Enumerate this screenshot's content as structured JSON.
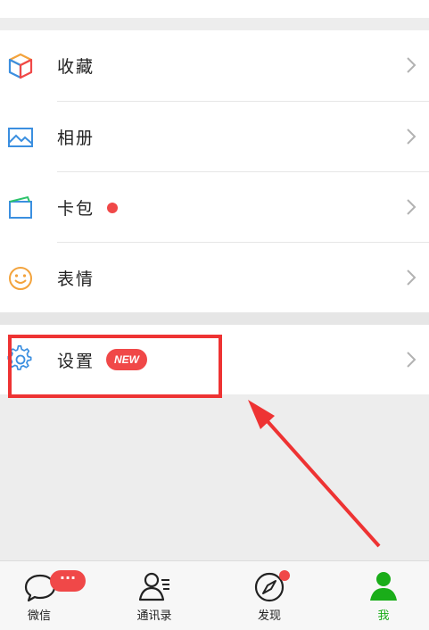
{
  "menu": {
    "items": [
      {
        "label": "收藏",
        "icon": "favorites-cube-icon"
      },
      {
        "label": "相册",
        "icon": "photo-album-icon"
      },
      {
        "label": "卡包",
        "icon": "card-wallet-icon",
        "has_dot": true
      },
      {
        "label": "表情",
        "icon": "smiley-icon"
      }
    ],
    "settings": {
      "label": "设置",
      "badge": "NEW",
      "icon": "gear-icon"
    }
  },
  "tabbar": {
    "tabs": [
      {
        "label": "微信",
        "icon": "chat-bubble-icon",
        "badge": "···"
      },
      {
        "label": "通讯录",
        "icon": "contacts-icon"
      },
      {
        "label": "发现",
        "icon": "compass-icon",
        "has_dot": true
      },
      {
        "label": "我",
        "icon": "person-icon",
        "active": true
      }
    ]
  },
  "colors": {
    "accent_red": "#f04848",
    "highlight_red": "#ee3333",
    "active_green": "#1aad19",
    "icon_blue": "#3b8fe0"
  }
}
